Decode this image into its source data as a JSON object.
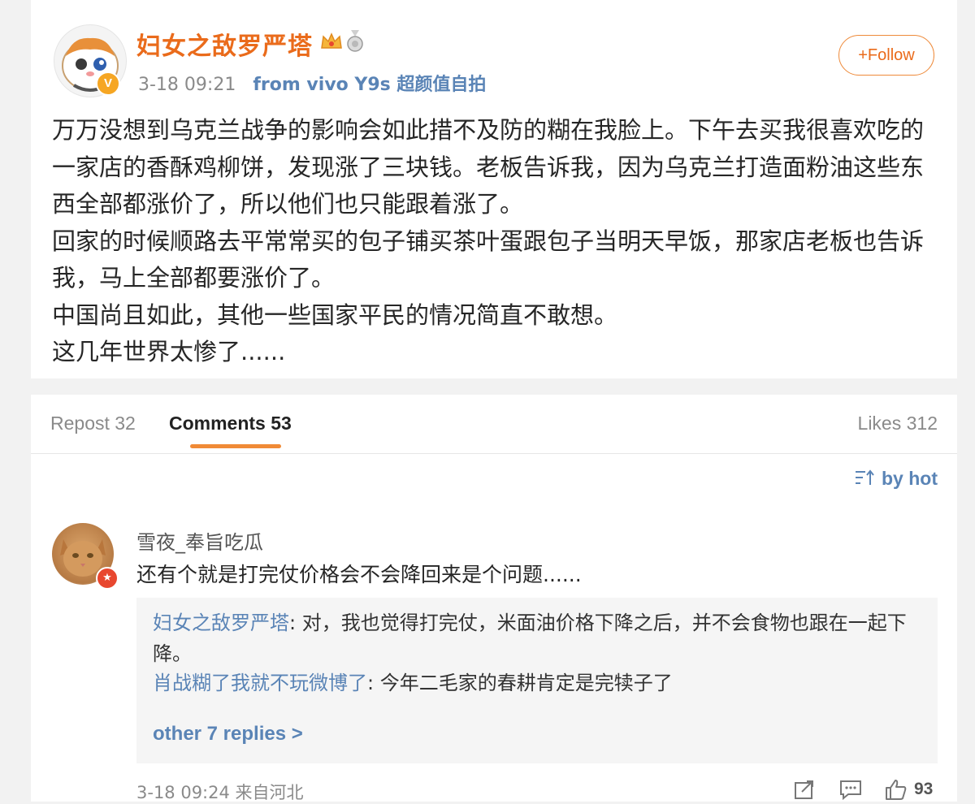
{
  "post": {
    "username": "妇女之敌罗严塔",
    "badge_letter": "V",
    "time": "3-18 09:21",
    "source": "from vivo Y9s 超颜值自拍",
    "follow_label": "+Follow",
    "paragraphs": [
      "万万没想到乌克兰战争的影响会如此措不及防的糊在我脸上。下午去买我很喜欢吃的一家店的香酥鸡柳饼，发现涨了三块钱。老板告诉我，因为乌克兰打造面粉油这些东西全部都涨价了，所以他们也只能跟着涨了。",
      "回家的时候顺路去平常常买的包子铺买茶叶蛋跟包子当明天早饭，那家店老板也告诉我，马上全部都要涨价了。",
      "中国尚且如此，其他一些国家平民的情况简直不敢想。",
      "这几年世界太惨了......"
    ]
  },
  "tabs": {
    "repost": "Repost 32",
    "comments": "Comments 53",
    "likes": "Likes 312"
  },
  "sort_label": "by hot",
  "comment": {
    "username": "雪夜_奉旨吃瓜",
    "text": "还有个就是打完仗价格会不会降回来是个问题......",
    "replies": [
      {
        "user": "妇女之敌罗严塔",
        "text": ": 对，我也觉得打完仗，米面油价格下降之后，并不会食物也跟在一起下降。"
      },
      {
        "user": "肖战糊了我就不玩微博了",
        "text": ": 今年二毛家的春耕肯定是完犊子了"
      }
    ],
    "more_replies": "other 7 replies >",
    "time": "3-18 09:24 来自河北",
    "like_count": "93"
  },
  "colors": {
    "username": "#ea6b1b",
    "link": "#5a84b6",
    "accent": "#f08a36",
    "background": "#f2f2f2"
  },
  "icons": [
    "crown-icon",
    "medal-icon",
    "sort-icon",
    "share-icon",
    "comment-icon",
    "like-icon"
  ]
}
